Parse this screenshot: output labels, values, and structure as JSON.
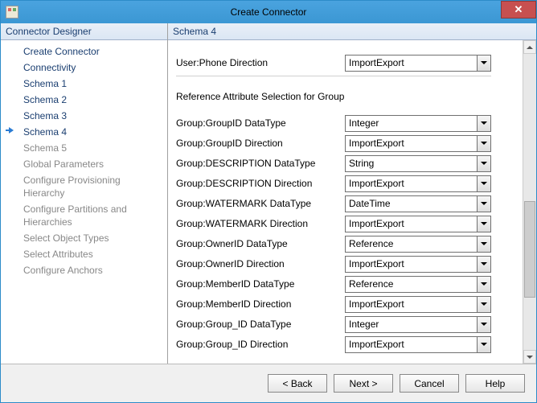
{
  "window": {
    "title": "Create Connector",
    "close_glyph": "✕"
  },
  "left": {
    "header": "Connector Designer",
    "items": [
      {
        "label": "Create Connector",
        "enabled": true,
        "current": false
      },
      {
        "label": "Connectivity",
        "enabled": true,
        "current": false
      },
      {
        "label": "Schema 1",
        "enabled": true,
        "current": false
      },
      {
        "label": "Schema 2",
        "enabled": true,
        "current": false
      },
      {
        "label": "Schema 3",
        "enabled": true,
        "current": false
      },
      {
        "label": "Schema 4",
        "enabled": true,
        "current": true
      },
      {
        "label": "Schema 5",
        "enabled": false,
        "current": false
      },
      {
        "label": "Global Parameters",
        "enabled": false,
        "current": false
      },
      {
        "label": "Configure Provisioning Hierarchy",
        "enabled": false,
        "current": false
      },
      {
        "label": "Configure Partitions and Hierarchies",
        "enabled": false,
        "current": false
      },
      {
        "label": "Select Object Types",
        "enabled": false,
        "current": false
      },
      {
        "label": "Select Attributes",
        "enabled": false,
        "current": false
      },
      {
        "label": "Configure Anchors",
        "enabled": false,
        "current": false
      }
    ]
  },
  "right": {
    "header": "Schema 4",
    "top_row": {
      "label": "User:Phone Direction",
      "value": "ImportExport"
    },
    "section_title": "Reference Attribute Selection for Group",
    "rows": [
      {
        "label": "Group:GroupID DataType",
        "value": "Integer"
      },
      {
        "label": "Group:GroupID Direction",
        "value": "ImportExport"
      },
      {
        "label": "Group:DESCRIPTION DataType",
        "value": "String"
      },
      {
        "label": "Group:DESCRIPTION Direction",
        "value": "ImportExport"
      },
      {
        "label": "Group:WATERMARK DataType",
        "value": "DateTime"
      },
      {
        "label": "Group:WATERMARK Direction",
        "value": "ImportExport"
      },
      {
        "label": "Group:OwnerID DataType",
        "value": "Reference"
      },
      {
        "label": "Group:OwnerID Direction",
        "value": "ImportExport"
      },
      {
        "label": "Group:MemberID DataType",
        "value": "Reference"
      },
      {
        "label": "Group:MemberID Direction",
        "value": "ImportExport"
      },
      {
        "label": "Group:Group_ID DataType",
        "value": "Integer"
      },
      {
        "label": "Group:Group_ID Direction",
        "value": "ImportExport"
      }
    ]
  },
  "footer": {
    "back": "<  Back",
    "next": "Next  >",
    "cancel": "Cancel",
    "help": "Help"
  }
}
